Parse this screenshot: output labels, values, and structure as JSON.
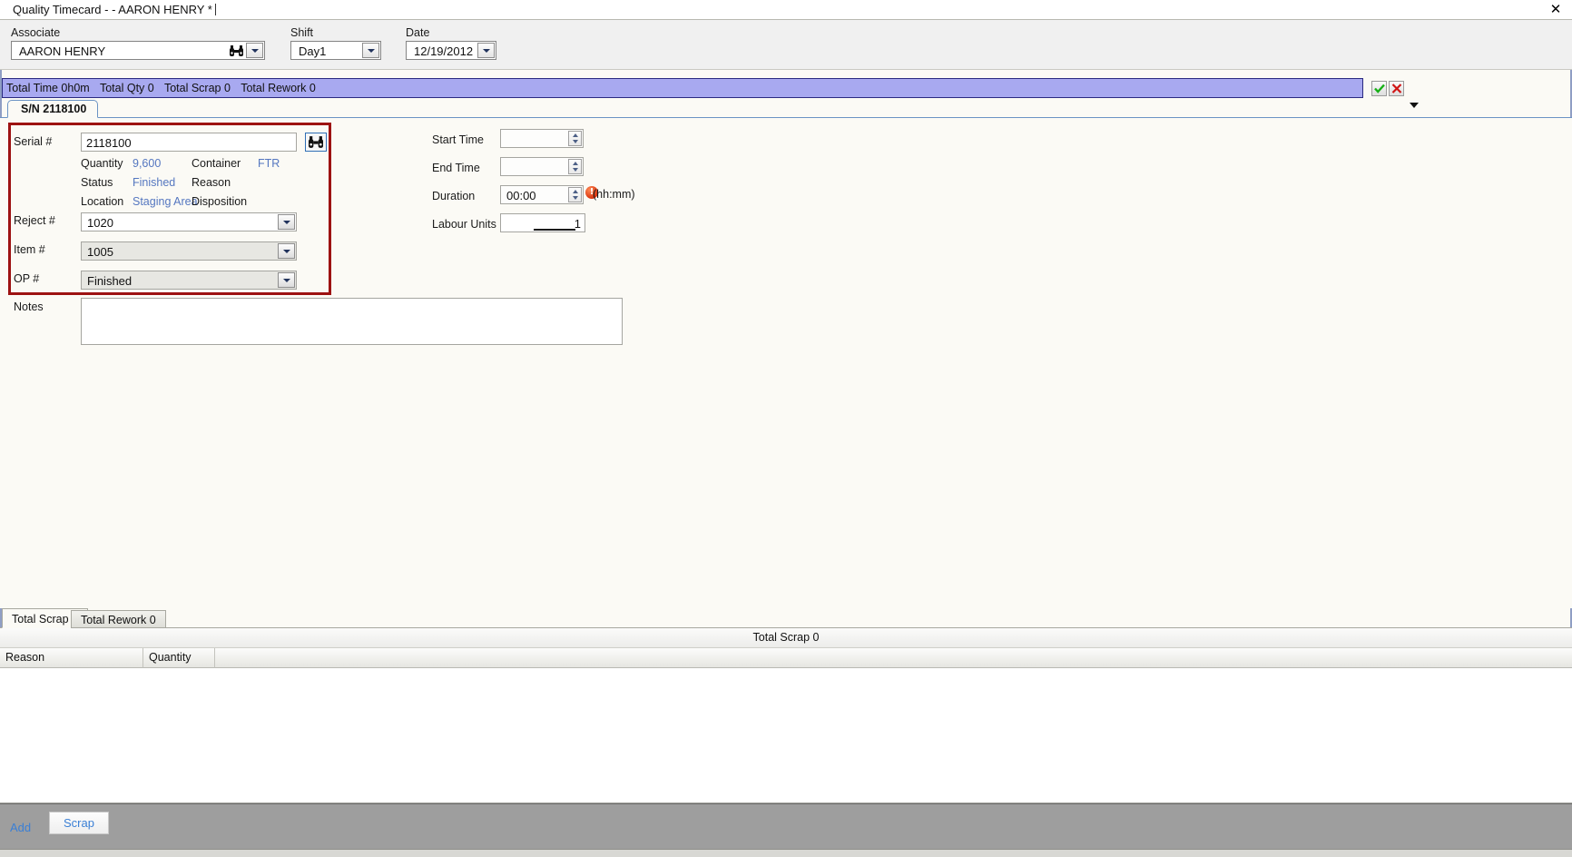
{
  "window": {
    "tab_title": "Quality Timecard - - AARON HENRY *",
    "close_icon": "close-icon"
  },
  "filters": {
    "associate": {
      "label": "Associate",
      "value": "AARON HENRY",
      "icon": "binoculars-icon"
    },
    "shift": {
      "label": "Shift",
      "value": "Day1"
    },
    "date": {
      "label": "Date",
      "value": "12/19/2012"
    }
  },
  "summary": {
    "total_time": "Total Time 0h0m",
    "total_qty": "Total Qty 0",
    "total_scrap": "Total Scrap 0",
    "total_rework": "Total Rework 0",
    "accept_icon": "check-icon",
    "cancel_icon": "x-icon",
    "collapse_icon": "chevron-down-icon",
    "bar_color": "#a8a9f0"
  },
  "serial_tab": {
    "label": "S/N 2118100"
  },
  "form": {
    "serial": {
      "label": "Serial #",
      "value": "2118100",
      "lookup_icon": "binoculars-icon"
    },
    "details": [
      {
        "label": "Quantity",
        "value": "9,600",
        "label2": "Container",
        "value2": "FTR"
      },
      {
        "label": "Status",
        "value": "Finished",
        "label2": "Reason",
        "value2": ""
      },
      {
        "label": "Location",
        "value": "Staging Area",
        "label2": "Disposition",
        "value2": ""
      }
    ],
    "reject": {
      "label": "Reject #",
      "value": "1020"
    },
    "item": {
      "label": "Item #",
      "value": "1005"
    },
    "op": {
      "label": "OP #",
      "value": "Finished"
    },
    "notes": {
      "label": "Notes",
      "value": ""
    },
    "start_time": {
      "label": "Start Time",
      "value": ""
    },
    "end_time": {
      "label": "End Time",
      "value": ""
    },
    "duration": {
      "label": "Duration",
      "value": "00:00",
      "hint": "(hh:mm)",
      "badge": "!",
      "badge_icon": "error-icon"
    },
    "labour_units": {
      "label": "Labour Units",
      "value": "1"
    },
    "highlight_color": "#9d1212",
    "link_color": "#5577c0"
  },
  "bottom": {
    "tabs": [
      {
        "label": "Total Scrap 0",
        "active": true
      },
      {
        "label": "Total Rework 0",
        "active": false
      }
    ],
    "grid_caption": "Total Scrap 0",
    "columns": [
      "Reason",
      "Quantity"
    ],
    "rows": []
  },
  "actions": {
    "add_label": "Add",
    "scrap_label": "Scrap",
    "link_color": "#3a7fd5"
  }
}
